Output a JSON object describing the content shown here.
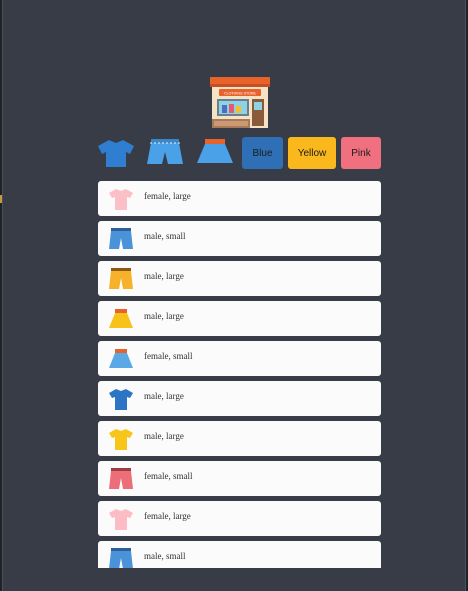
{
  "store": {
    "sign_text": "CLOTHING STORE"
  },
  "filters": {
    "types": [
      {
        "name": "shirt-filter",
        "icon": "shirt-icon",
        "color": "#2f7ecf"
      },
      {
        "name": "shorts-filter",
        "icon": "shorts-icon",
        "color": "#4aa1e8"
      },
      {
        "name": "skirt-filter",
        "icon": "skirt-icon",
        "color": "#4aa1e8"
      }
    ],
    "colors": [
      {
        "label": "Blue",
        "color": "#2f6fb5"
      },
      {
        "label": "Yellow",
        "color": "#fbb81c"
      },
      {
        "label": "Pink",
        "color": "#f0707f"
      }
    ]
  },
  "items": [
    {
      "icon": "shirt-icon",
      "color": "#fbbfc8",
      "text": "female, large"
    },
    {
      "icon": "shorts-icon",
      "color": "#4a93d9",
      "text": "male, small"
    },
    {
      "icon": "shorts-icon",
      "color": "#f6b22a",
      "text": "male, large"
    },
    {
      "icon": "skirt-icon",
      "color": "#f8c21c",
      "text": "male, large"
    },
    {
      "icon": "skirt-icon",
      "color": "#5aa8e6",
      "text": "female, small"
    },
    {
      "icon": "shirt-icon",
      "color": "#2c74c4",
      "text": "male, large"
    },
    {
      "icon": "shirt-icon",
      "color": "#f8c61a",
      "text": "male, large"
    },
    {
      "icon": "shorts-icon",
      "color": "#ec6e79",
      "text": "female, small"
    },
    {
      "icon": "shirt-icon",
      "color": "#fbbcc6",
      "text": "female, large"
    },
    {
      "icon": "shorts-icon",
      "color": "#4a93d9",
      "text": "male, small"
    }
  ]
}
